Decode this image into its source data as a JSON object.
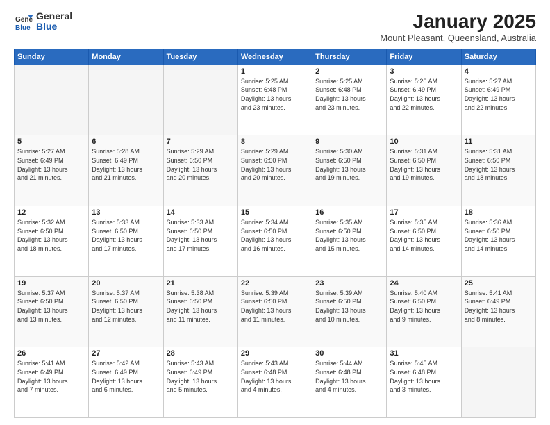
{
  "header": {
    "logo_general": "General",
    "logo_blue": "Blue",
    "month_title": "January 2025",
    "location": "Mount Pleasant, Queensland, Australia"
  },
  "weekdays": [
    "Sunday",
    "Monday",
    "Tuesday",
    "Wednesday",
    "Thursday",
    "Friday",
    "Saturday"
  ],
  "weeks": [
    [
      {
        "day": "",
        "info": ""
      },
      {
        "day": "",
        "info": ""
      },
      {
        "day": "",
        "info": ""
      },
      {
        "day": "1",
        "info": "Sunrise: 5:25 AM\nSunset: 6:48 PM\nDaylight: 13 hours\nand 23 minutes."
      },
      {
        "day": "2",
        "info": "Sunrise: 5:25 AM\nSunset: 6:48 PM\nDaylight: 13 hours\nand 23 minutes."
      },
      {
        "day": "3",
        "info": "Sunrise: 5:26 AM\nSunset: 6:49 PM\nDaylight: 13 hours\nand 22 minutes."
      },
      {
        "day": "4",
        "info": "Sunrise: 5:27 AM\nSunset: 6:49 PM\nDaylight: 13 hours\nand 22 minutes."
      }
    ],
    [
      {
        "day": "5",
        "info": "Sunrise: 5:27 AM\nSunset: 6:49 PM\nDaylight: 13 hours\nand 21 minutes."
      },
      {
        "day": "6",
        "info": "Sunrise: 5:28 AM\nSunset: 6:49 PM\nDaylight: 13 hours\nand 21 minutes."
      },
      {
        "day": "7",
        "info": "Sunrise: 5:29 AM\nSunset: 6:50 PM\nDaylight: 13 hours\nand 20 minutes."
      },
      {
        "day": "8",
        "info": "Sunrise: 5:29 AM\nSunset: 6:50 PM\nDaylight: 13 hours\nand 20 minutes."
      },
      {
        "day": "9",
        "info": "Sunrise: 5:30 AM\nSunset: 6:50 PM\nDaylight: 13 hours\nand 19 minutes."
      },
      {
        "day": "10",
        "info": "Sunrise: 5:31 AM\nSunset: 6:50 PM\nDaylight: 13 hours\nand 19 minutes."
      },
      {
        "day": "11",
        "info": "Sunrise: 5:31 AM\nSunset: 6:50 PM\nDaylight: 13 hours\nand 18 minutes."
      }
    ],
    [
      {
        "day": "12",
        "info": "Sunrise: 5:32 AM\nSunset: 6:50 PM\nDaylight: 13 hours\nand 18 minutes."
      },
      {
        "day": "13",
        "info": "Sunrise: 5:33 AM\nSunset: 6:50 PM\nDaylight: 13 hours\nand 17 minutes."
      },
      {
        "day": "14",
        "info": "Sunrise: 5:33 AM\nSunset: 6:50 PM\nDaylight: 13 hours\nand 17 minutes."
      },
      {
        "day": "15",
        "info": "Sunrise: 5:34 AM\nSunset: 6:50 PM\nDaylight: 13 hours\nand 16 minutes."
      },
      {
        "day": "16",
        "info": "Sunrise: 5:35 AM\nSunset: 6:50 PM\nDaylight: 13 hours\nand 15 minutes."
      },
      {
        "day": "17",
        "info": "Sunrise: 5:35 AM\nSunset: 6:50 PM\nDaylight: 13 hours\nand 14 minutes."
      },
      {
        "day": "18",
        "info": "Sunrise: 5:36 AM\nSunset: 6:50 PM\nDaylight: 13 hours\nand 14 minutes."
      }
    ],
    [
      {
        "day": "19",
        "info": "Sunrise: 5:37 AM\nSunset: 6:50 PM\nDaylight: 13 hours\nand 13 minutes."
      },
      {
        "day": "20",
        "info": "Sunrise: 5:37 AM\nSunset: 6:50 PM\nDaylight: 13 hours\nand 12 minutes."
      },
      {
        "day": "21",
        "info": "Sunrise: 5:38 AM\nSunset: 6:50 PM\nDaylight: 13 hours\nand 11 minutes."
      },
      {
        "day": "22",
        "info": "Sunrise: 5:39 AM\nSunset: 6:50 PM\nDaylight: 13 hours\nand 11 minutes."
      },
      {
        "day": "23",
        "info": "Sunrise: 5:39 AM\nSunset: 6:50 PM\nDaylight: 13 hours\nand 10 minutes."
      },
      {
        "day": "24",
        "info": "Sunrise: 5:40 AM\nSunset: 6:50 PM\nDaylight: 13 hours\nand 9 minutes."
      },
      {
        "day": "25",
        "info": "Sunrise: 5:41 AM\nSunset: 6:49 PM\nDaylight: 13 hours\nand 8 minutes."
      }
    ],
    [
      {
        "day": "26",
        "info": "Sunrise: 5:41 AM\nSunset: 6:49 PM\nDaylight: 13 hours\nand 7 minutes."
      },
      {
        "day": "27",
        "info": "Sunrise: 5:42 AM\nSunset: 6:49 PM\nDaylight: 13 hours\nand 6 minutes."
      },
      {
        "day": "28",
        "info": "Sunrise: 5:43 AM\nSunset: 6:49 PM\nDaylight: 13 hours\nand 5 minutes."
      },
      {
        "day": "29",
        "info": "Sunrise: 5:43 AM\nSunset: 6:48 PM\nDaylight: 13 hours\nand 4 minutes."
      },
      {
        "day": "30",
        "info": "Sunrise: 5:44 AM\nSunset: 6:48 PM\nDaylight: 13 hours\nand 4 minutes."
      },
      {
        "day": "31",
        "info": "Sunrise: 5:45 AM\nSunset: 6:48 PM\nDaylight: 13 hours\nand 3 minutes."
      },
      {
        "day": "",
        "info": ""
      }
    ]
  ]
}
